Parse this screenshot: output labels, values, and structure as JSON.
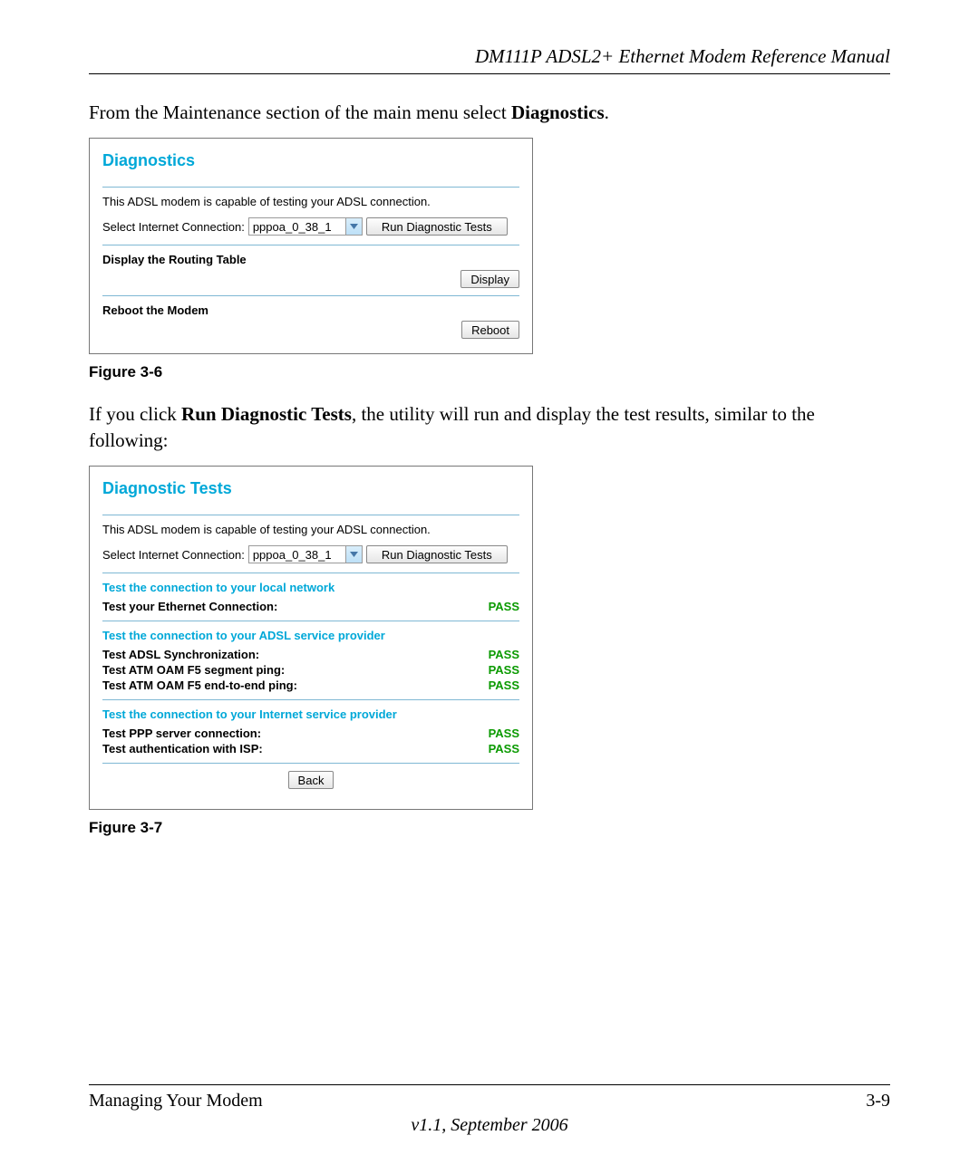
{
  "header": {
    "title": "DM111P ADSL2+ Ethernet Modem Reference Manual"
  },
  "intro": {
    "prefix": "From the Maintenance section of the main menu select ",
    "bold": "Diagnostics",
    "suffix": "."
  },
  "panel1": {
    "title": "Diagnostics",
    "desc": "This ADSL modem is capable of testing your ADSL connection.",
    "select_label": "Select Internet Connection:",
    "select_value": "pppoa_0_38_1",
    "run_btn": "Run Diagnostic Tests",
    "routing_label": "Display the Routing Table",
    "display_btn": "Display",
    "reboot_label": "Reboot the Modem",
    "reboot_btn": "Reboot"
  },
  "fig1": "Figure 3-6",
  "mid": {
    "p1a": "If you click ",
    "p1b": "Run Diagnostic Tests",
    "p1c": ", the utility will run and display the test results, similar to the following:"
  },
  "panel2": {
    "title": "Diagnostic Tests",
    "desc": "This ADSL modem is capable of testing your ADSL connection.",
    "select_label": "Select Internet Connection:",
    "select_value": "pppoa_0_38_1",
    "run_btn": "Run Diagnostic Tests",
    "sec_local": "Test the connection to your local network",
    "eth_label": "Test your Ethernet Connection:",
    "eth_result": "PASS",
    "sec_adsl": "Test the connection to your ADSL service provider",
    "sync_label": "Test ADSL Synchronization:",
    "sync_result": "PASS",
    "seg_label": "Test ATM OAM F5 segment ping:",
    "seg_result": "PASS",
    "e2e_label": "Test ATM OAM F5 end-to-end ping:",
    "e2e_result": "PASS",
    "sec_isp": "Test the connection to your Internet service provider",
    "ppp_label": "Test PPP server connection:",
    "ppp_result": "PASS",
    "auth_label": "Test authentication with ISP:",
    "auth_result": "PASS",
    "back_btn": "Back"
  },
  "fig2": "Figure 3-7",
  "footer": {
    "left": "Managing Your Modem",
    "right": "3-9",
    "version": "v1.1, September 2006"
  }
}
